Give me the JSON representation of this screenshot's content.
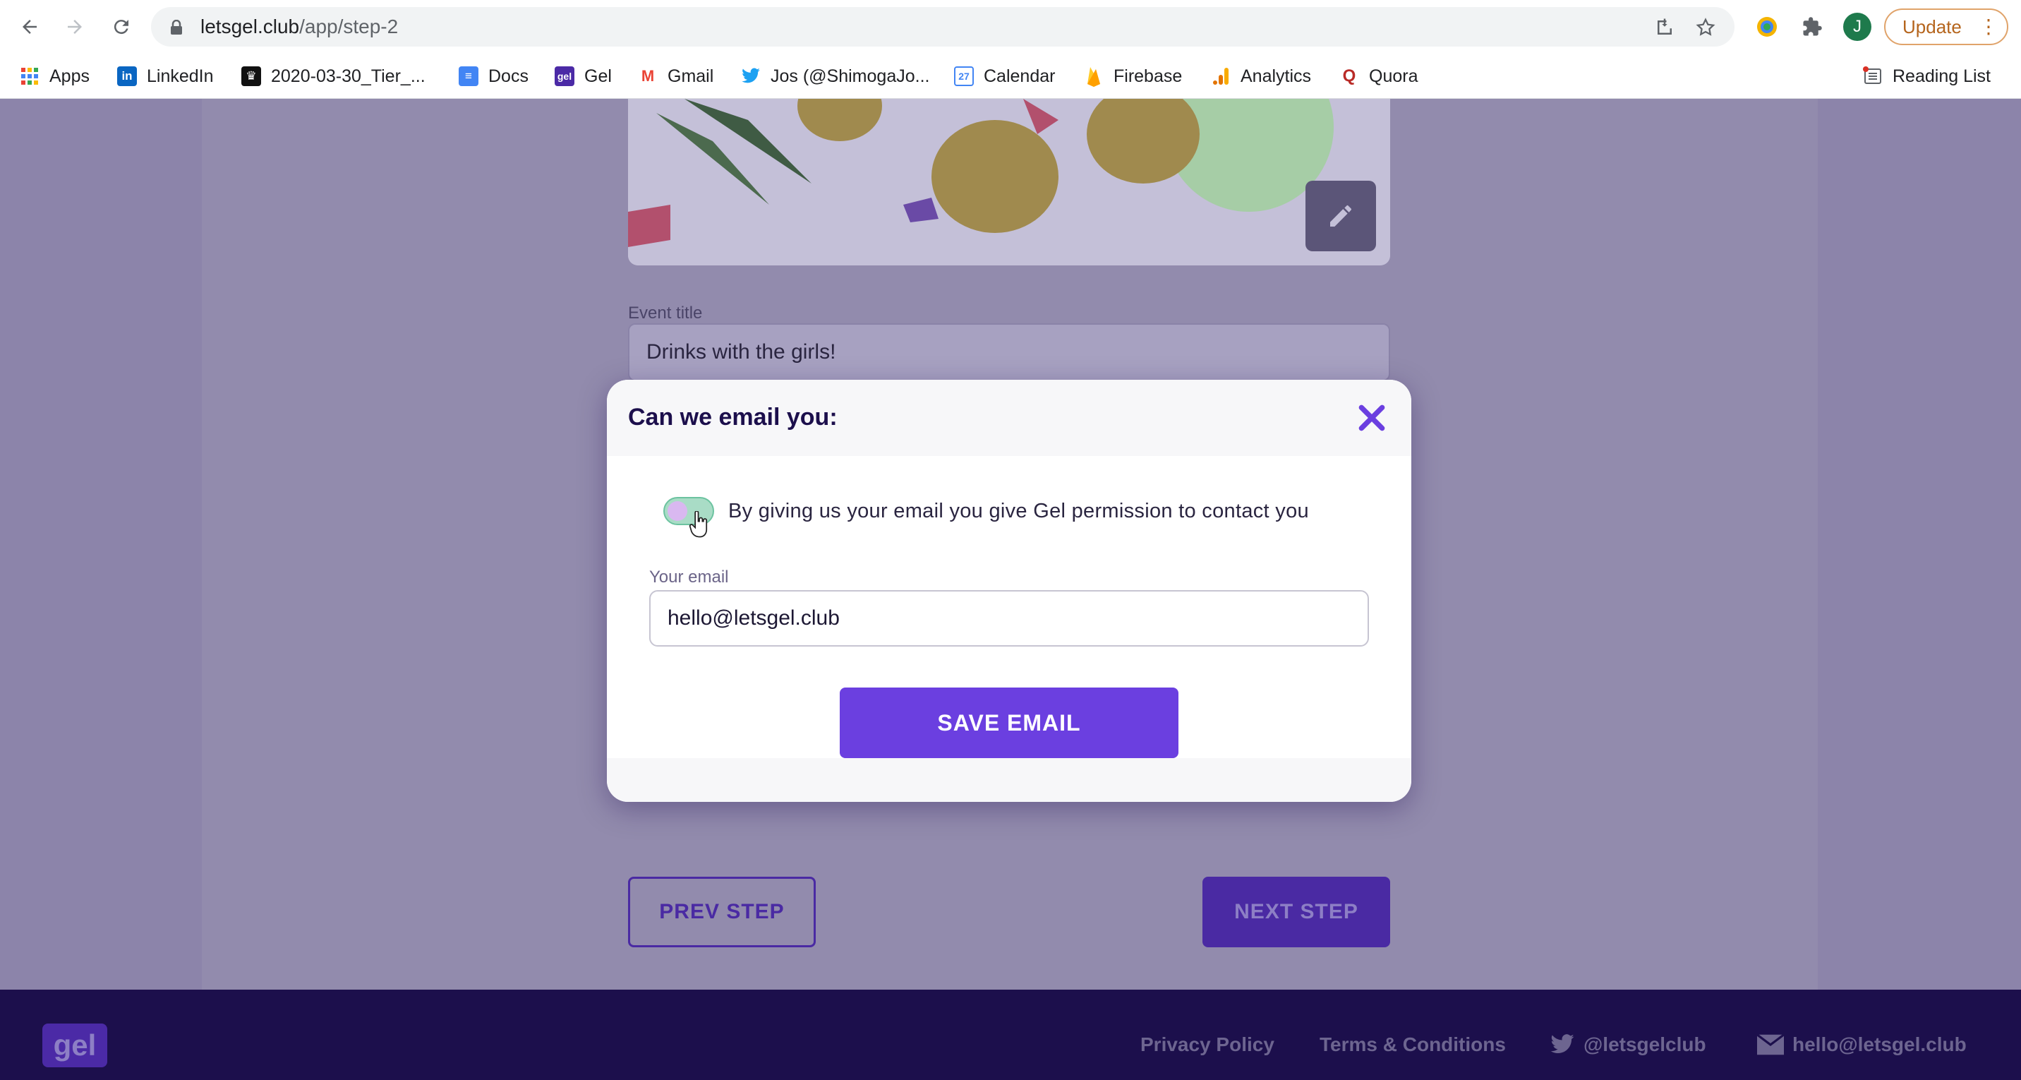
{
  "browser": {
    "url_host": "letsgel.club",
    "url_path": "/app/step-2",
    "avatar_initial": "J",
    "update_label": "Update",
    "reading_list": "Reading List"
  },
  "bookmarks": [
    {
      "label": "Apps",
      "icon": "apps-grid-icon"
    },
    {
      "label": "LinkedIn",
      "icon": "linkedin-icon"
    },
    {
      "label": "2020-03-30_Tier_...",
      "icon": "crown-icon"
    },
    {
      "label": "Docs",
      "icon": "docs-icon"
    },
    {
      "label": "Gel",
      "icon": "gel-icon"
    },
    {
      "label": "Gmail",
      "icon": "gmail-icon"
    },
    {
      "label": "Jos (@ShimogaJo...",
      "icon": "twitter-icon"
    },
    {
      "label": "Calendar",
      "icon": "calendar-icon"
    },
    {
      "label": "Firebase",
      "icon": "firebase-icon"
    },
    {
      "label": "Analytics",
      "icon": "analytics-icon"
    },
    {
      "label": "Quora",
      "icon": "quora-icon"
    }
  ],
  "page": {
    "event_title_label": "Event title",
    "event_title_value": "Drinks with the girls!",
    "prev_step": "PREV STEP",
    "next_step": "NEXT STEP"
  },
  "modal": {
    "title": "Can we email you:",
    "consent_text": "By giving us your email you give Gel permission to contact you",
    "email_label": "Your email",
    "email_value": "hello@letsgel.club",
    "save_label": "SAVE EMAIL"
  },
  "footer": {
    "logo": "gel",
    "privacy": "Privacy Policy",
    "terms": "Terms & Conditions",
    "twitter": "@letsgelclub",
    "email": "hello@letsgel.club"
  },
  "colors": {
    "brand_purple": "#6b3fe0",
    "dark_navy": "#1c0f4c",
    "overlay": "#8c84aa"
  }
}
